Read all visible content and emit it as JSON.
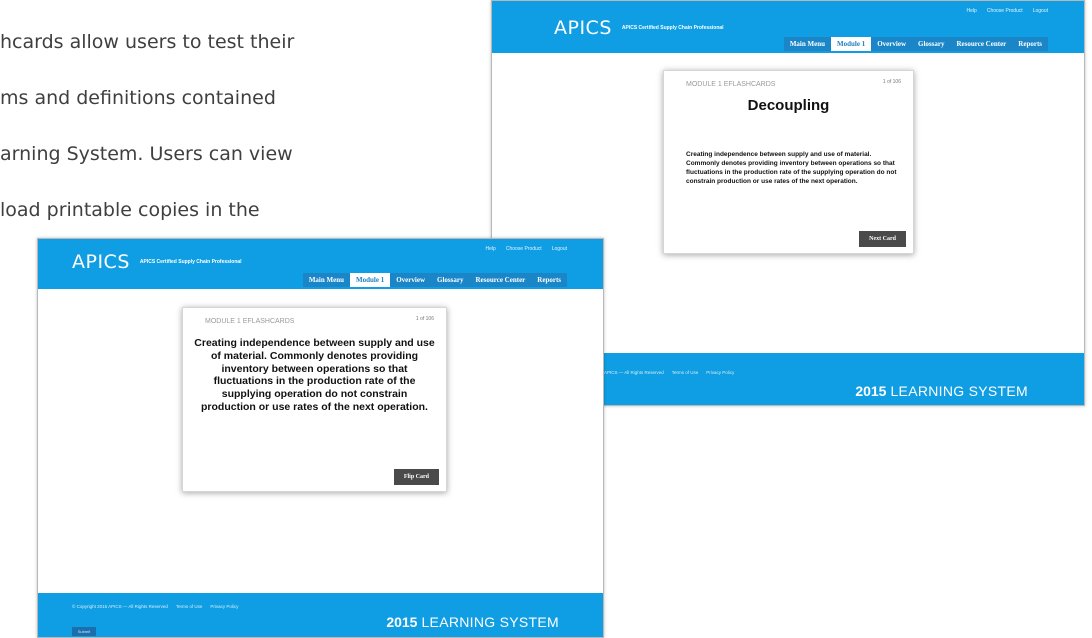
{
  "intro_lines": [
    "hcards allow users to test their",
    "ms and definitions contained",
    "arning System. Users can view",
    "load printable copies in the"
  ],
  "header": {
    "logo": "APICS",
    "subtitle": "APICS Certified Supply Chain Professional",
    "top_links": [
      "Help",
      "Choose Product",
      "Logout"
    ],
    "nav": [
      "Main Menu",
      "Module 1",
      "Overview",
      "Glossary",
      "Resource Center",
      "Reports"
    ],
    "active_nav": "Module 1"
  },
  "back_screen": {
    "card_module": "MODULE 1 EFLASHCARDS",
    "card_count": "1 of 106",
    "card_term": "Decoupling",
    "card_definition": "Creating independence between supply and use of material. Commonly denotes providing inventory between operations so that fluctuations in the production rate of the supplying operation do not constrain production or use rates of the next operation.",
    "card_button": "Next Card",
    "footer_links": [
      "APICS — All Rights Reserved",
      "Terms of Use",
      "Privacy Policy"
    ]
  },
  "front_screen": {
    "card_module": "MODULE 1 EFLASHCARDS",
    "card_count": "1 of 106",
    "card_definition": "Creating independence between supply and use of material. Commonly denotes providing inventory between operations so that fluctuations in the production rate of the supplying operation do not constrain production or use rates of the next operation.",
    "card_button": "Flip Card",
    "footer_links": [
      "© Copyright 2015 APICS — All Rights Reserved",
      "Terms of Use",
      "Privacy Policy"
    ],
    "footer_button": "Submit"
  },
  "footer_brand": {
    "year": "2015",
    "text": "LEARNING SYSTEM"
  },
  "colors": {
    "header_blue": "#0f9ee3",
    "tab_blue": "#1a86c8",
    "button_dark": "#4a4a4a"
  }
}
